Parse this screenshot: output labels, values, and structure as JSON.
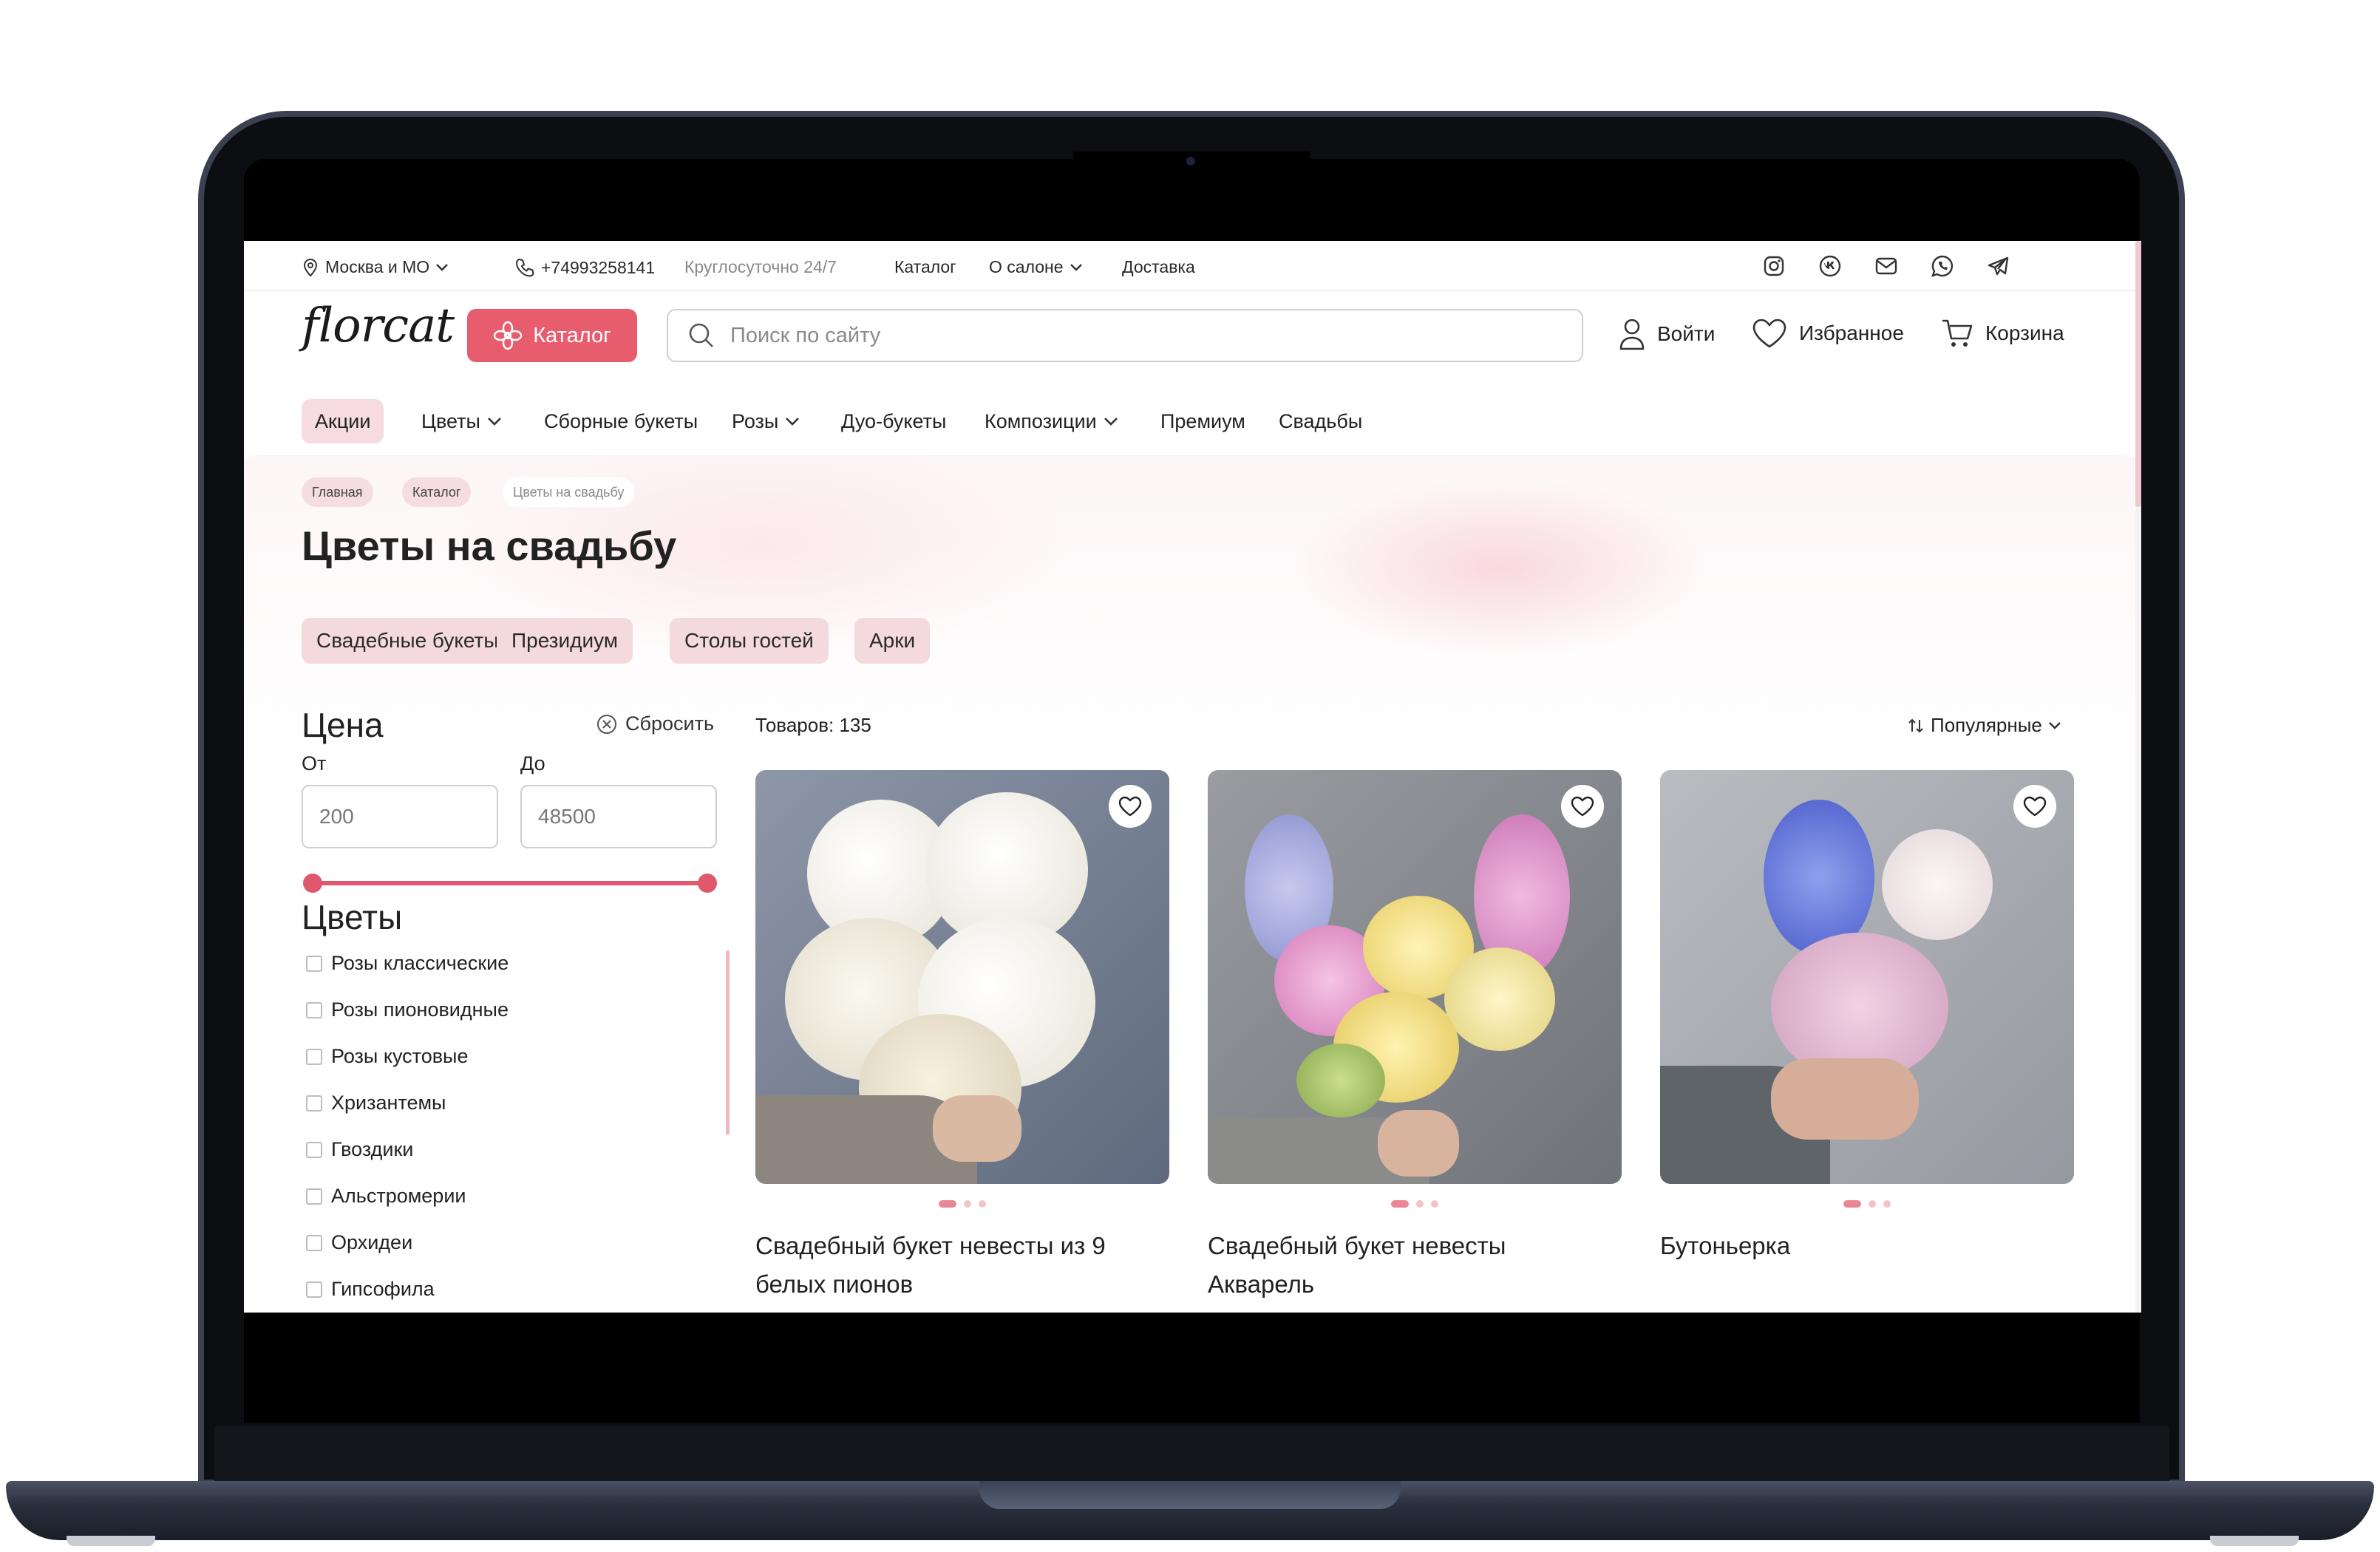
{
  "topbar": {
    "city": "Москва и МО",
    "phone": "+74993258141",
    "hours": "Круглосуточно 24/7",
    "links": [
      "Каталог",
      "О салоне",
      "Доставка"
    ]
  },
  "header": {
    "logo": "florcat",
    "catalog_button": "Каталог",
    "search_placeholder": "Поиск по сайту",
    "login": "Войти",
    "favorites": "Избранное",
    "cart": "Корзина"
  },
  "nav": {
    "items": [
      "Акции",
      "Цветы",
      "Сборные букеты",
      "Розы",
      "Дуо-букеты",
      "Композиции",
      "Премиум",
      "Свадьбы"
    ]
  },
  "breadcrumbs": [
    "Главная",
    "Каталог",
    "Цветы на свадьбу"
  ],
  "page_title": "Цветы на свадьбу",
  "subcategories": [
    "Свадебные букеты",
    "Президиум",
    "Столы гостей",
    "Арки"
  ],
  "filters": {
    "price_title": "Цена",
    "reset": "Сбросить",
    "from_label": "От",
    "to_label": "До",
    "from_value": "200",
    "to_value": "48500",
    "flowers_title": "Цветы",
    "flowers": [
      "Розы классические",
      "Розы пионовидные",
      "Розы кустовые",
      "Хризантемы",
      "Гвоздики",
      "Альстромерии",
      "Орхидеи",
      "Гипсофила"
    ]
  },
  "products": {
    "count_text": "Товаров: 135",
    "sort_label": "Популярные",
    "items": [
      {
        "title": "Свадебный букет невесты из 9 белых пионов"
      },
      {
        "title": "Свадебный букет невесты Акварель"
      },
      {
        "title": "Бутоньерка"
      }
    ]
  },
  "colors": {
    "accent": "#e85d6e",
    "chip_bg": "#f4d9dd"
  }
}
